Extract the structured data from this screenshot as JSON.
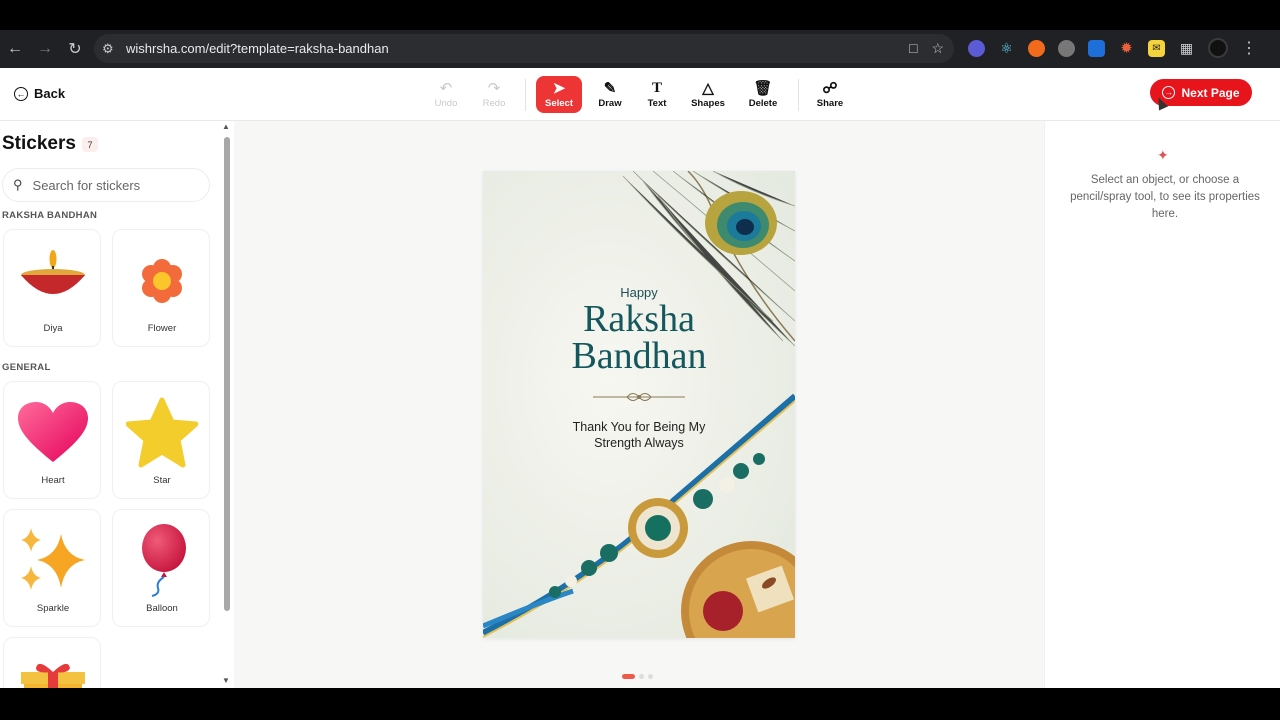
{
  "browser": {
    "url": "wishrsha.com/edit?template=raksha-bandhan"
  },
  "toolbar": {
    "back_label": "Back",
    "tools": [
      {
        "label": "Undo",
        "icon": "undo-icon",
        "state": "disabled"
      },
      {
        "label": "Redo",
        "icon": "redo-icon",
        "state": "disabled"
      },
      {
        "label": "Select",
        "icon": "cursor-icon",
        "state": "active"
      },
      {
        "label": "Draw",
        "icon": "pencil-icon",
        "state": "normal"
      },
      {
        "label": "Text",
        "icon": "text-icon",
        "state": "normal"
      },
      {
        "label": "Shapes",
        "icon": "shapes-icon",
        "state": "normal"
      },
      {
        "label": "Delete",
        "icon": "trash-icon",
        "state": "normal"
      },
      {
        "label": "Share",
        "icon": "share-icon",
        "state": "normal"
      }
    ],
    "next_label": "Next Page",
    "accent": "#e8141c"
  },
  "sidebar": {
    "title": "Stickers",
    "count": "7",
    "search_placeholder": "Search for stickers",
    "sections": [
      {
        "label": "RAKSHA BANDHAN",
        "items": [
          {
            "label": "Diya"
          },
          {
            "label": "Flower"
          }
        ]
      },
      {
        "label": "GENERAL",
        "items": [
          {
            "label": "Heart"
          },
          {
            "label": "Star"
          },
          {
            "label": "Sparkle"
          },
          {
            "label": "Balloon"
          }
        ]
      }
    ]
  },
  "card": {
    "happy": "Happy",
    "title_line1": "Raksha",
    "title_line2": "Bandhan",
    "subtitle_line1": "Thank You for Being My",
    "subtitle_line2": "Strength Always"
  },
  "properties": {
    "message": "Select an object, or choose a pencil/spray tool, to see its properties here."
  }
}
